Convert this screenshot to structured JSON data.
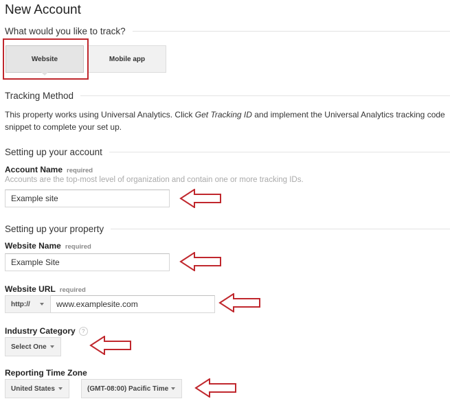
{
  "page": {
    "title": "New Account"
  },
  "track": {
    "heading": "What would you like to track?",
    "options": [
      {
        "label": "Website",
        "selected": true
      },
      {
        "label": "Mobile app",
        "selected": false
      }
    ]
  },
  "tracking_method": {
    "heading": "Tracking Method",
    "text_before": "This property works using Universal Analytics. Click ",
    "text_emphasis": "Get Tracking ID",
    "text_after": " and implement the Universal Analytics tracking code snippet to complete your set up."
  },
  "account": {
    "heading": "Setting up your account",
    "name_label": "Account Name",
    "required": "required",
    "hint": "Accounts are the top-most level of organization and contain one or more tracking IDs.",
    "name_value": "Example site"
  },
  "property": {
    "heading": "Setting up your property",
    "website_name_label": "Website Name",
    "website_name_required": "required",
    "website_name_value": "Example Site",
    "url_label": "Website URL",
    "url_required": "required",
    "url_protocol": "http://",
    "url_value": "www.examplesite.com",
    "industry_label": "Industry Category",
    "industry_help": "?",
    "industry_value": "Select One",
    "timezone_label": "Reporting Time Zone",
    "timezone_country": "United States",
    "timezone_value": "(GMT-08:00) Pacific Time"
  },
  "annotation": {
    "color": "#c0272d"
  }
}
